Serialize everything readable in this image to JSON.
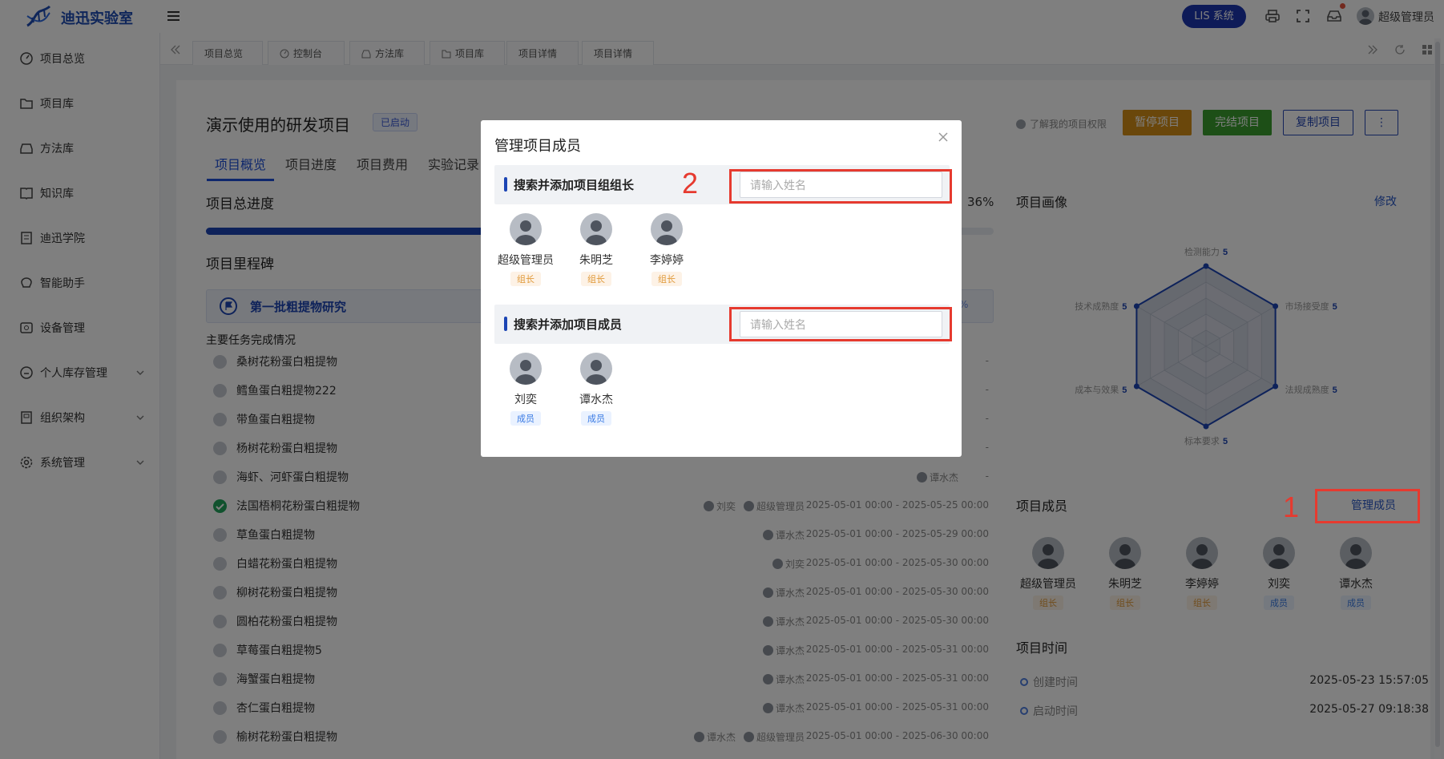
{
  "app": {
    "brand": "迪迅实验室",
    "lis_button": "LIS 系统",
    "user": "超级管理员"
  },
  "sidebar": {
    "items": [
      {
        "label": "项目总览",
        "icon": "dashboard-icon",
        "has_children": false
      },
      {
        "label": "项目库",
        "icon": "folder-icon",
        "has_children": false
      },
      {
        "label": "方法库",
        "icon": "tray-icon",
        "has_children": false
      },
      {
        "label": "知识库",
        "icon": "book-icon",
        "has_children": false
      },
      {
        "label": "迪迅学院",
        "icon": "building-icon",
        "has_children": false
      },
      {
        "label": "智能助手",
        "icon": "brain-icon",
        "has_children": false
      },
      {
        "label": "设备管理",
        "icon": "device-icon",
        "has_children": false
      },
      {
        "label": "个人库存管理",
        "icon": "inventory-icon",
        "has_children": true
      },
      {
        "label": "组织架构",
        "icon": "org-icon",
        "has_children": true
      },
      {
        "label": "系统管理",
        "icon": "gear-icon",
        "has_children": true
      }
    ]
  },
  "tabs": [
    {
      "label": "项目总览",
      "icon": null
    },
    {
      "label": "控制台",
      "icon": "dashboard-icon"
    },
    {
      "label": "方法库",
      "icon": "tray-icon"
    },
    {
      "label": "项目库",
      "icon": "folder-icon"
    },
    {
      "label": "项目详情",
      "icon": null
    },
    {
      "label": "项目详情",
      "icon": null
    }
  ],
  "project": {
    "title": "演示使用的研发项目",
    "status": "已启动",
    "tabs": [
      "项目概览",
      "项目进度",
      "项目费用",
      "实验记录"
    ],
    "progress_title": "项目总进度",
    "progress_percent": 36,
    "progress_label": "36%",
    "milestone_title": "项目里程碑",
    "milestone_name": "第一批粗提物研究",
    "milestone_pct": "%",
    "tasks_title": "主要任务完成情况",
    "tasks": [
      {
        "name": "桑树花粉蛋白粗提物",
        "done": false,
        "people": [],
        "date": "-"
      },
      {
        "name": "鳕鱼蛋白粗提物222",
        "done": false,
        "people": [],
        "date": "-"
      },
      {
        "name": "带鱼蛋白粗提物",
        "done": false,
        "people": [],
        "date": "-"
      },
      {
        "name": "杨树花粉蛋白粗提物",
        "done": false,
        "people": [],
        "date": "-"
      },
      {
        "name": "海虾、河虾蛋白粗提物",
        "done": false,
        "people": [
          "谭水杰"
        ],
        "date": "-"
      },
      {
        "name": "法国梧桐花粉蛋白粗提物",
        "done": true,
        "people": [
          "刘奕",
          "超级管理员"
        ],
        "date": "2025-05-01 00:00 - 2025-05-25 00:00"
      },
      {
        "name": "草鱼蛋白粗提物",
        "done": false,
        "people": [
          "谭水杰"
        ],
        "date": "2025-05-01 00:00 - 2025-05-29 00:00"
      },
      {
        "name": "白蜡花粉蛋白粗提物",
        "done": false,
        "people": [
          "刘奕"
        ],
        "date": "2025-05-01 00:00 - 2025-05-30 00:00"
      },
      {
        "name": "柳树花粉蛋白粗提物",
        "done": false,
        "people": [
          "谭水杰"
        ],
        "date": "2025-05-01 00:00 - 2025-05-30 00:00"
      },
      {
        "name": "圆柏花粉蛋白粗提物",
        "done": false,
        "people": [
          "谭水杰"
        ],
        "date": "2025-05-01 00:00 - 2025-05-30 00:00"
      },
      {
        "name": "草莓蛋白粗提物5",
        "done": false,
        "people": [
          "谭水杰"
        ],
        "date": "2025-05-01 00:00 - 2025-05-31 00:00"
      },
      {
        "name": "海蟹蛋白粗提物",
        "done": false,
        "people": [
          "谭水杰"
        ],
        "date": "2025-05-01 00:00 - 2025-05-31 00:00"
      },
      {
        "name": "杏仁蛋白粗提物",
        "done": false,
        "people": [
          "谭水杰"
        ],
        "date": "2025-05-01 00:00 - 2025-05-31 00:00"
      },
      {
        "name": "榆树花粉蛋白粗提物",
        "done": false,
        "people": [
          "谭水杰",
          "超级管理员"
        ],
        "date": "2025-05-01 00:00 - 2025-06-30 00:00"
      }
    ]
  },
  "right_panel": {
    "tip": "了解我的项目权限",
    "buttons": {
      "pause": "暂停项目",
      "finish": "完结项目",
      "copy": "复制项目",
      "more": "⋮"
    },
    "portrait_title": "项目画像",
    "edit": "修改",
    "radar_axes": [
      {
        "label": "检测能力",
        "value": "5"
      },
      {
        "label": "市场接受度",
        "value": "5"
      },
      {
        "label": "法规成熟度",
        "value": "5"
      },
      {
        "label": "标本要求",
        "value": "5"
      },
      {
        "label": "成本与效果",
        "value": "5"
      },
      {
        "label": "技术成熟度",
        "value": "5"
      }
    ],
    "members_title": "项目成员",
    "manage_button": "管理成员",
    "members": [
      {
        "name": "超级管理员",
        "role": "组长",
        "role_type": "leader"
      },
      {
        "name": "朱明芝",
        "role": "组长",
        "role_type": "leader"
      },
      {
        "name": "李婷婷",
        "role": "组长",
        "role_type": "leader"
      },
      {
        "name": "刘奕",
        "role": "成员",
        "role_type": "member"
      },
      {
        "name": "谭水杰",
        "role": "成员",
        "role_type": "member"
      }
    ],
    "time_title": "项目时间",
    "times": [
      {
        "label": "创建时间",
        "value": "2025-05-23 15:57:05"
      },
      {
        "label": "启动时间",
        "value": "2025-05-27 09:18:38"
      }
    ]
  },
  "modal": {
    "title": "管理项目成员",
    "leader_section": {
      "title": "搜索并添加项目组组长",
      "placeholder": "请输入姓名",
      "value": "",
      "members": [
        {
          "name": "超级管理员",
          "role": "组长"
        },
        {
          "name": "朱明芝",
          "role": "组长"
        },
        {
          "name": "李婷婷",
          "role": "组长"
        }
      ]
    },
    "member_section": {
      "title": "搜索并添加项目成员",
      "placeholder": "请输入姓名",
      "value": "",
      "members": [
        {
          "name": "刘奕",
          "role": "成员"
        },
        {
          "name": "谭水杰",
          "role": "成员"
        }
      ]
    }
  },
  "annotations": {
    "step1": "1",
    "step2": "2"
  },
  "colors": {
    "brand": "#1f4db5",
    "primary": "#1c45b4",
    "highlight": "#e63a2f",
    "pause": "#d48e16",
    "finish": "#3a9e2f"
  }
}
